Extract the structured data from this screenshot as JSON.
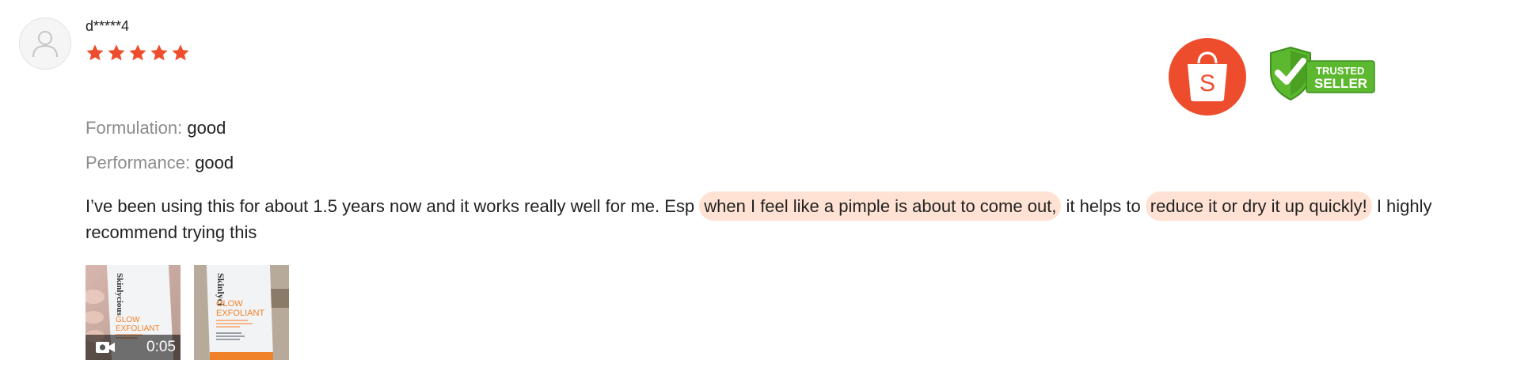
{
  "reviewer": {
    "username": "d*****4",
    "avatar_icon": "default-user-icon",
    "rating": 5,
    "max_rating": 5
  },
  "badges": {
    "shop_icon": "shopee-bag-icon",
    "shop_letter": "S",
    "trusted_line1": "TRUSTED",
    "trusted_line2": "SELLER"
  },
  "attributes": [
    {
      "key": "Formulation:",
      "value": "good"
    },
    {
      "key": "Performance:",
      "value": "good"
    }
  ],
  "comment": {
    "part1": "I’ve been using this for about 1.5 years now and it works really well for me. Esp ",
    "highlight1": "when I feel like a pimple is about to come out,",
    "part2": " it helps to ",
    "highlight2": "reduce it or dry it up quickly!",
    "part3": " I highly recommend trying this"
  },
  "media": [
    {
      "type": "video",
      "duration": "0:05",
      "icon": "video-camera-icon",
      "brand_text": "Skinlycious",
      "product_line1": "GLOW",
      "product_line2": "EXFOLIANT"
    },
    {
      "type": "image",
      "brand_text": "Skinlyci",
      "product_line1": "GLOW",
      "product_line2": "EXFOLIANT"
    }
  ],
  "colors": {
    "star": "#ee4d2d",
    "highlight": "#ffe2d3",
    "shop_badge": "#ee4d2d",
    "trusted_green": "#5cb82e",
    "label_grey": "#8c8c8c",
    "product_orange": "#f0822a"
  }
}
